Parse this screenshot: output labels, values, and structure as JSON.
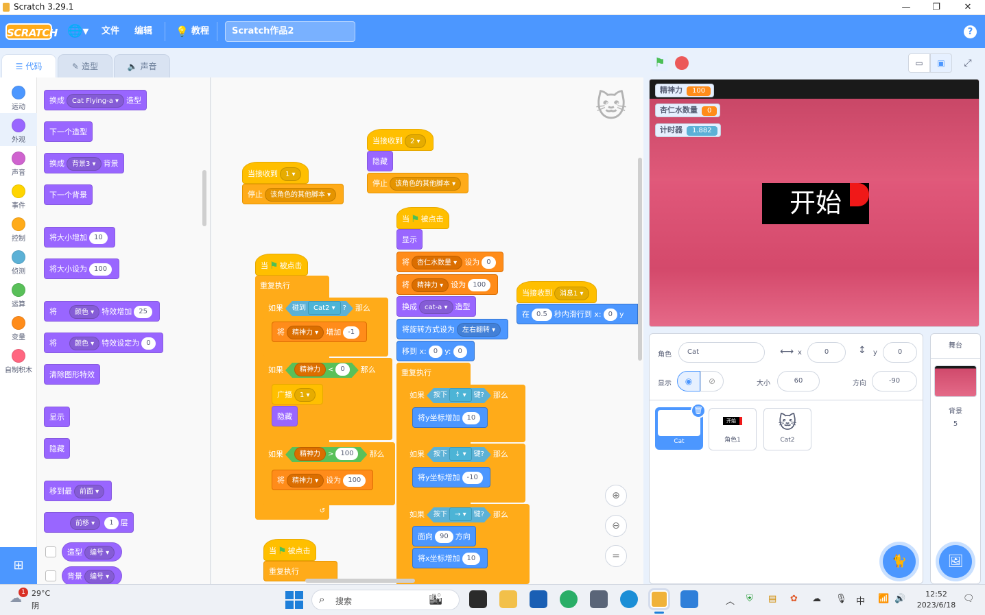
{
  "window": {
    "title": "Scratch 3.29.1",
    "min": "—",
    "max": "❐",
    "close": "✕"
  },
  "menubar": {
    "logo": "SCRATCH",
    "file": "文件",
    "edit": "编辑",
    "tutorials": "教程",
    "project_title": "Scratch作品2",
    "help": "?"
  },
  "tabs": {
    "code": "代码",
    "costumes": "造型",
    "sounds": "声音"
  },
  "categories": [
    {
      "label": "运动",
      "color": "#4c97ff"
    },
    {
      "label": "外观",
      "color": "#9966ff"
    },
    {
      "label": "声音",
      "color": "#cf63cf"
    },
    {
      "label": "事件",
      "color": "#ffd500"
    },
    {
      "label": "控制",
      "color": "#ffab19"
    },
    {
      "label": "侦测",
      "color": "#5cb1d6"
    },
    {
      "label": "运算",
      "color": "#59c059"
    },
    {
      "label": "变量",
      "color": "#ff8c1a"
    },
    {
      "label": "自制积木",
      "color": "#ff6680"
    }
  ],
  "palette": {
    "switch_costume": "换成",
    "costume_name": "Cat Flying-a",
    "costume_suffix": "造型",
    "next_costume": "下一个造型",
    "switch_backdrop": "换成",
    "backdrop_name": "背景3",
    "backdrop_suffix": "背景",
    "next_backdrop": "下一个背景",
    "change_size": "将大小增加",
    "change_size_val": "10",
    "set_size": "将大小设为",
    "set_size_val": "100",
    "change_effect": "将",
    "effect1": "颜色",
    "change_effect_mid": "特效增加",
    "change_effect_val": "25",
    "set_effect": "将",
    "effect2": "颜色",
    "set_effect_mid": "特效设定为",
    "set_effect_val": "0",
    "clear_effects": "清除图形特效",
    "show": "显示",
    "hide": "隐藏",
    "goto_layer": "移到最",
    "layer": "前面",
    "go_layer": "前移",
    "go_layer_val": "1",
    "go_layer_suffix": "层",
    "costume_reporter": "造型",
    "costume_prop": "编号",
    "backdrop_reporter": "背景",
    "backdrop_prop": "编号"
  },
  "scripts": {
    "when_receive": "当接收到",
    "msg1": "1",
    "msg2": "2",
    "msg_msg1": "消息1",
    "stop": "停止",
    "stop_opt": "该角色的其他脚本",
    "hide": "隐藏",
    "show": "显示",
    "when_flag": "当",
    "clicked": "被点击",
    "forever": "重复执行",
    "if": "如果",
    "then": "那么",
    "touching": "碰到",
    "touch_obj": "Cat2",
    "q": "?",
    "set": "将",
    "change_by": "增加",
    "set_to": "设为",
    "var_energy": "精神力",
    "var_almond": "杏仁水数量",
    "val_neg1": "-1",
    "val_0": "0",
    "val_100": "100",
    "lt": "<",
    "gt": ">",
    "broadcast": "广播",
    "broadcast_msg": "1",
    "switch_costume": "换成",
    "costume": "cat-a",
    "costume_suffix": "造型",
    "rotation": "将旋转方式设为",
    "rotation_opt": "左右翻转",
    "goto": "移到 x:",
    "goto_x": "0",
    "goto_y_lbl": "y:",
    "goto_y": "0",
    "key_pressed": "按下",
    "key_up": "↑",
    "key_down": "↓",
    "key_right": "→",
    "key_q": "键?",
    "change_y": "将y坐标增加",
    "change_y_10": "10",
    "change_y_neg10": "-10",
    "point_dir": "面向",
    "dir_90": "90",
    "dir_suffix": "方向",
    "change_x": "将x坐标增加",
    "change_x_10": "10",
    "glide": "在",
    "glide_secs": "0.5",
    "glide_mid": "秒内滑行到 x:",
    "glide_x": "0",
    "glide_y": "y"
  },
  "zoom": {
    "in": "+",
    "out": "−",
    "reset": "="
  },
  "stage": {
    "monitors": [
      {
        "label": "精神力",
        "value": "100",
        "color": "#ff8c1a"
      },
      {
        "label": "杏仁水数量",
        "value": "0",
        "color": "#ff8c1a"
      },
      {
        "label": "计时器",
        "value": "1.882",
        "color": "#5cb1d6"
      }
    ],
    "start_text": "开始"
  },
  "sprite_info": {
    "sprite_label": "角色",
    "sprite_name": "Cat",
    "x_label": "x",
    "x_val": "0",
    "y_label": "y",
    "y_val": "0",
    "show_label": "显示",
    "size_label": "大小",
    "size_val": "60",
    "dir_label": "方向",
    "dir_val": "-90"
  },
  "sprites": [
    {
      "name": "Cat"
    },
    {
      "name": "角色1",
      "thumb_text": "开始"
    },
    {
      "name": "Cat2"
    }
  ],
  "stage_panel": {
    "title": "舞台",
    "backdrop_label": "背景",
    "backdrop_count": "5"
  },
  "taskbar": {
    "weather_temp": "29°C",
    "weather_desc": "阴",
    "weather_badge": "1",
    "search": "搜索",
    "ime": "中",
    "time": "12:52",
    "date": "2023/6/18"
  }
}
